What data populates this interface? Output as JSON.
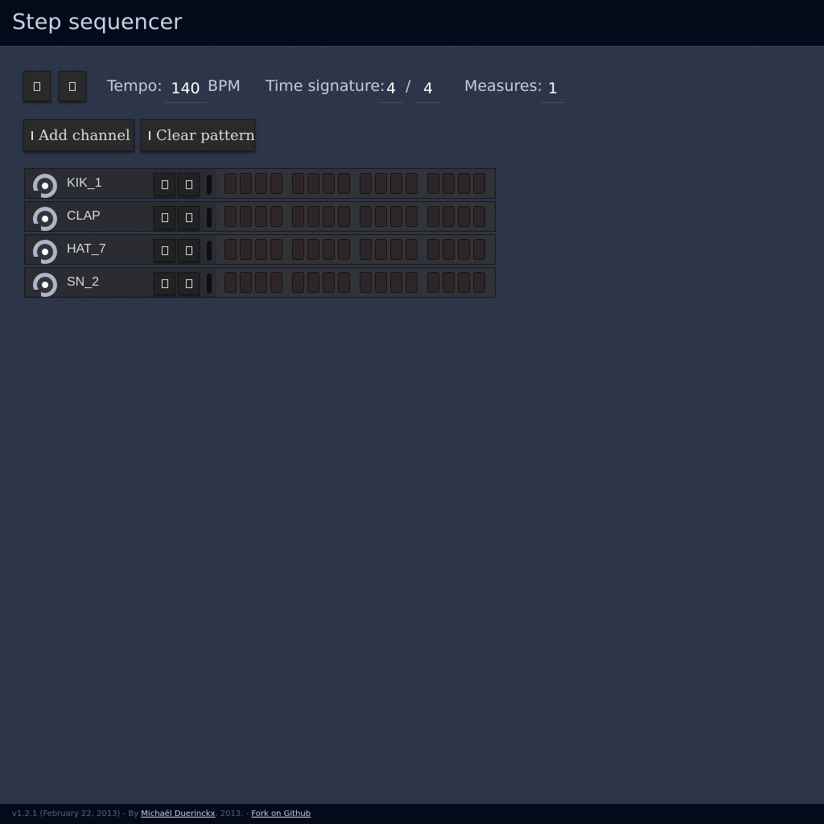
{
  "header": {
    "title": "Step sequencer"
  },
  "transport": {
    "play_icon": "box-glyph",
    "stop_icon": "box-glyph"
  },
  "settings": {
    "tempo_label": "Tempo:",
    "tempo_value": "140",
    "tempo_unit": "BPM",
    "time_sig_label": "Time signature:",
    "time_sig_numerator": "4",
    "time_sig_separator": "/",
    "time_sig_denominator": "4",
    "measures_label": "Measures:",
    "measures_value": "1"
  },
  "actions": {
    "add_channel_label": "Add channel",
    "clear_pattern_label": "Clear pattern"
  },
  "channels": [
    {
      "name": "KIK_1",
      "steps": [
        0,
        0,
        0,
        0,
        0,
        0,
        0,
        0,
        0,
        0,
        0,
        0,
        0,
        0,
        0,
        0
      ]
    },
    {
      "name": "CLAP",
      "steps": [
        0,
        0,
        0,
        0,
        0,
        0,
        0,
        0,
        0,
        0,
        0,
        0,
        0,
        0,
        0,
        0
      ]
    },
    {
      "name": "HAT_7",
      "steps": [
        0,
        0,
        0,
        0,
        0,
        0,
        0,
        0,
        0,
        0,
        0,
        0,
        0,
        0,
        0,
        0
      ]
    },
    {
      "name": "SN_2",
      "steps": [
        0,
        0,
        0,
        0,
        0,
        0,
        0,
        0,
        0,
        0,
        0,
        0,
        0,
        0,
        0,
        0
      ]
    }
  ],
  "footer": {
    "prefix": "v1.2.1 (February 22, 2013) - By ",
    "author_link": "Michaël Duerinckx",
    "middle": ", 2013. - ",
    "github_link": "Fork on Github"
  },
  "colors": {
    "background": "#2c3447",
    "topbar": "#050a1a",
    "step_off": "#2c2628",
    "knob": "#aeb6c6"
  }
}
